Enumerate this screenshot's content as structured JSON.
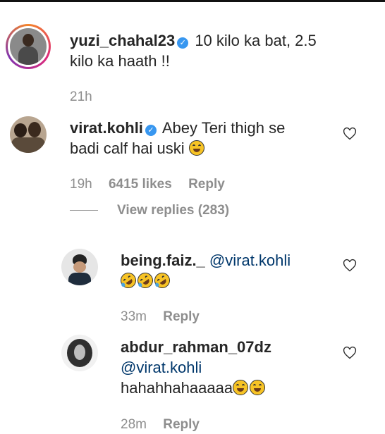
{
  "comments": [
    {
      "username": "yuzi_chahal23",
      "text_line1": "10 kilo ka bat, 2.5",
      "text_line2": "kilo ka haath !!",
      "time": "21h"
    },
    {
      "username": "virat.kohli",
      "text_line1": "Abey Teri thigh se",
      "text_line2": "badi calf hai uski",
      "time": "19h",
      "likes": "6415 likes",
      "reply_label": "Reply",
      "view_replies": "View replies (283)"
    }
  ],
  "replies": [
    {
      "username": "being.faiz._",
      "mention": "@virat.kohli",
      "time": "33m",
      "reply_label": "Reply"
    },
    {
      "username": "abdur_rahman_07dz",
      "mention": "@virat.kohli",
      "text": "hahahhahaaaaa",
      "time": "28m",
      "reply_label": "Reply"
    }
  ],
  "icons": {
    "verified": "verified-badge-icon",
    "heart": "heart-outline-icon",
    "emoji_tears": "face-with-tears-of-joy-emoji",
    "emoji_rofl": "rolling-on-floor-laughing-emoji"
  },
  "colors": {
    "verified": "#3897f0",
    "mention": "#00376b",
    "meta": "#8e8e8e"
  }
}
